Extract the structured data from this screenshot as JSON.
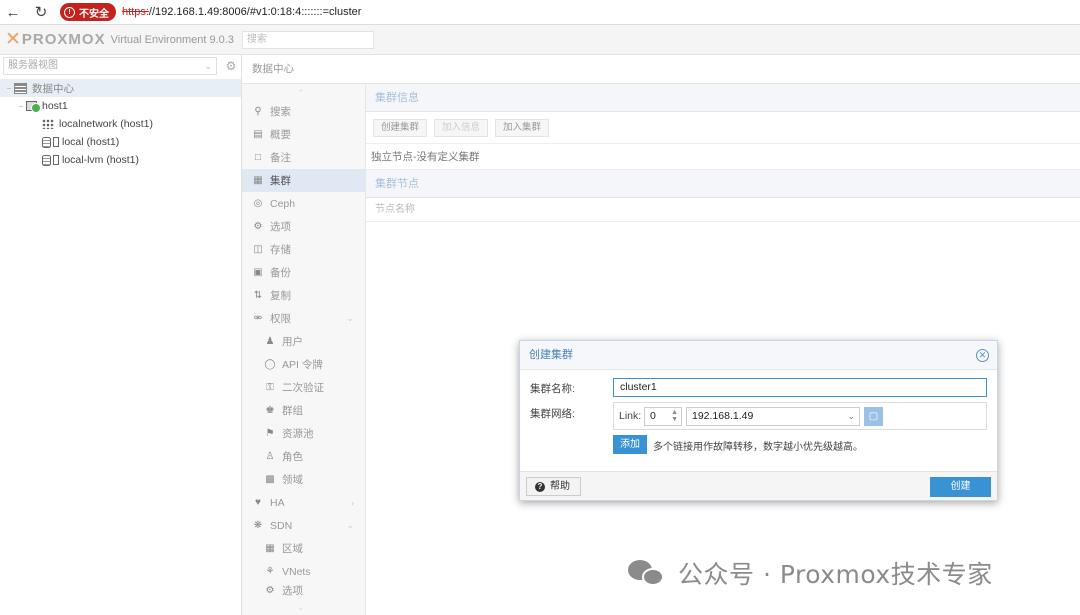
{
  "browser": {
    "insecure_label": "不安全",
    "url_scheme": "https:",
    "url_rest": "//192.168.1.49:8006/#v1:0:18:4:::::::=cluster"
  },
  "header": {
    "logo_text": "PROXMOX",
    "version": "Virtual Environment 9.0.3",
    "search_placeholder": "搜索"
  },
  "left": {
    "view_select": "服务器视图",
    "tree": {
      "datacenter": "数据中心",
      "host": "host1",
      "localnetwork": "localnetwork (host1)",
      "local": "local (host1)",
      "local_lvm": "local-lvm (host1)"
    }
  },
  "breadcrumb": "数据中心",
  "nav": {
    "search": "搜索",
    "summary": "概要",
    "notes": "备注",
    "cluster": "集群",
    "ceph": "Ceph",
    "options": "选项",
    "storage": "存储",
    "backup": "备份",
    "replication": "复制",
    "permissions": "权限",
    "users": "用户",
    "api_tokens": "API 令牌",
    "two_factor": "二次验证",
    "groups": "群组",
    "pools": "资源池",
    "roles": "角色",
    "realms": "领域",
    "ha": "HA",
    "sdn": "SDN",
    "zones": "区域",
    "vnets": "VNets",
    "options2": "选项"
  },
  "content": {
    "cluster_info_title": "集群信息",
    "btn_create": "创建集群",
    "btn_join_info": "加入信息",
    "btn_join": "加入集群",
    "info_line": "独立节点-没有定义集群",
    "cluster_nodes_title": "集群节点",
    "col_node_name": "节点名称"
  },
  "dialog": {
    "title": "创建集群",
    "name_label": "集群名称:",
    "name_value": "cluster1",
    "network_label": "集群网络:",
    "link_label": "Link:",
    "link_number": "0",
    "address": "192.168.1.49",
    "add_label": "添加",
    "add_hint": "多个链接用作故障转移，数字越小优先级越高。",
    "help_label": "帮助",
    "create_label": "创建"
  },
  "watermark": "公众号 · Proxmox技术专家",
  "colors": {
    "accent": "#3892d4",
    "danger": "#c5221f",
    "logo_orange": "#f0a060"
  }
}
